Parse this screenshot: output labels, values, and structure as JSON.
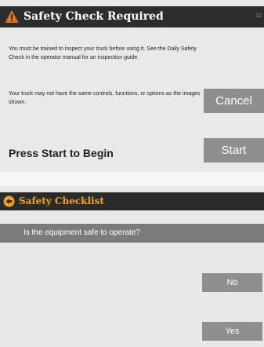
{
  "safety_check_screen": {
    "title": "Safety Check Required",
    "corner_text": "12",
    "instructions": "You must be trained to inspect your truck before using it. See the Daily Safety Check in the operator manual for an inspection guide.",
    "disclaimer": "Your truck may not have the same controls, functions, or options as the images shown.",
    "cancel_label": "Cancel",
    "start_label": "Start",
    "prompt": "Press Start to Begin",
    "colors": {
      "header_bg": "#2d2d2d",
      "warning_icon": "#e2751f",
      "button_bg": "#8e8e8e"
    }
  },
  "checklist_screen": {
    "title": "Safety Checklist",
    "question": "Is the equipment safe to operate?",
    "no_label": "No",
    "yes_label": "Yes",
    "colors": {
      "header_bg": "#2b2b2b",
      "accent": "#f2a31e",
      "question_bar_bg": "#7b7b7b"
    }
  },
  "icons": {
    "warning": "warning-triangle-icon",
    "back": "back-arrow-icon"
  }
}
